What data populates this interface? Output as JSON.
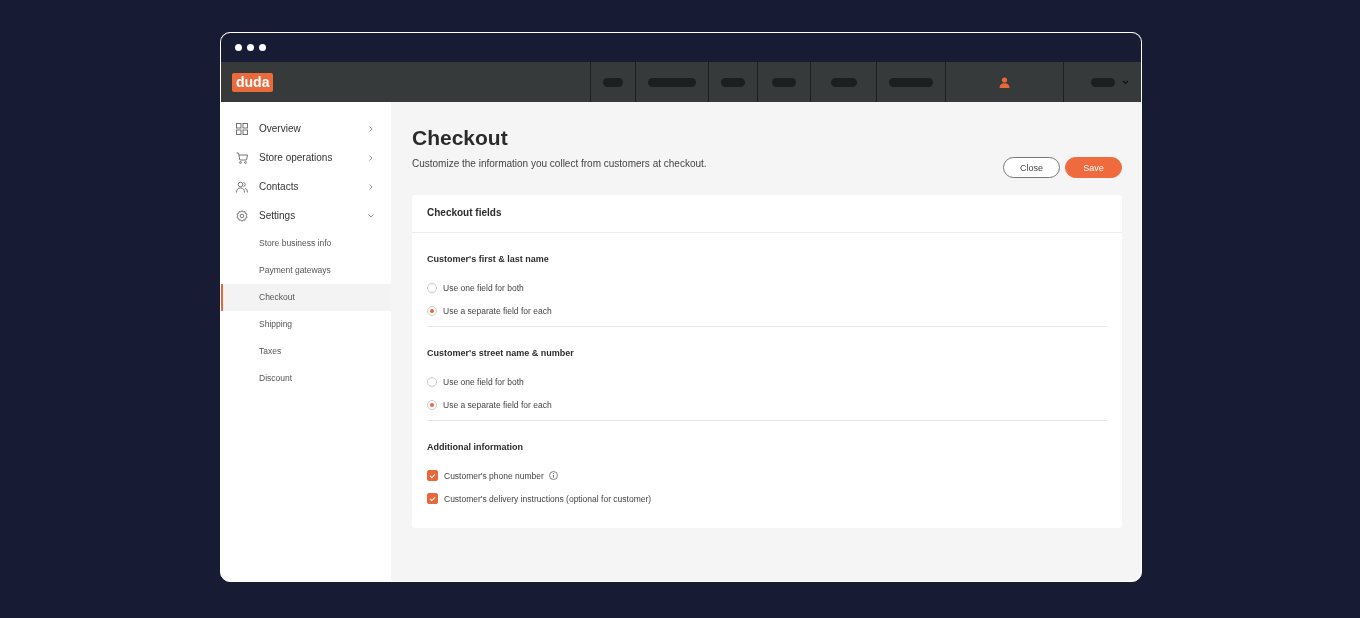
{
  "logo": "duda",
  "sidebar": {
    "items": [
      {
        "label": "Overview",
        "expanded": false
      },
      {
        "label": "Store operations",
        "expanded": false
      },
      {
        "label": "Contacts",
        "expanded": false
      },
      {
        "label": "Settings",
        "expanded": true,
        "children": [
          {
            "label": "Store business info",
            "selected": false
          },
          {
            "label": "Payment gateways",
            "selected": false
          },
          {
            "label": "Checkout",
            "selected": true
          },
          {
            "label": "Shipping",
            "selected": false
          },
          {
            "label": "Taxes",
            "selected": false
          },
          {
            "label": "Discount",
            "selected": false
          }
        ]
      }
    ]
  },
  "page": {
    "title": "Checkout",
    "subtitle": "Customize the information you collect from customers at checkout.",
    "buttons": [
      {
        "label": "Close",
        "kind": "outline"
      },
      {
        "label": "Save",
        "kind": "primary"
      }
    ]
  },
  "card": {
    "title": "Checkout fields",
    "sections": [
      {
        "title": "Customer's first & last name",
        "kind": "radio",
        "options": [
          {
            "label": "Use one field for both",
            "selected": false
          },
          {
            "label": "Use a separate field for each",
            "selected": true
          }
        ]
      },
      {
        "title": "Customer's street name & number",
        "kind": "radio",
        "options": [
          {
            "label": "Use one field for both",
            "selected": false
          },
          {
            "label": "Use a separate field for each",
            "selected": true
          }
        ]
      },
      {
        "title": "Additional information",
        "kind": "checkbox",
        "options": [
          {
            "label": "Customer's phone number",
            "checked": true,
            "info": true
          },
          {
            "label": "Customer's delivery instructions (optional for customer)",
            "checked": true,
            "info": false
          }
        ]
      }
    ]
  }
}
